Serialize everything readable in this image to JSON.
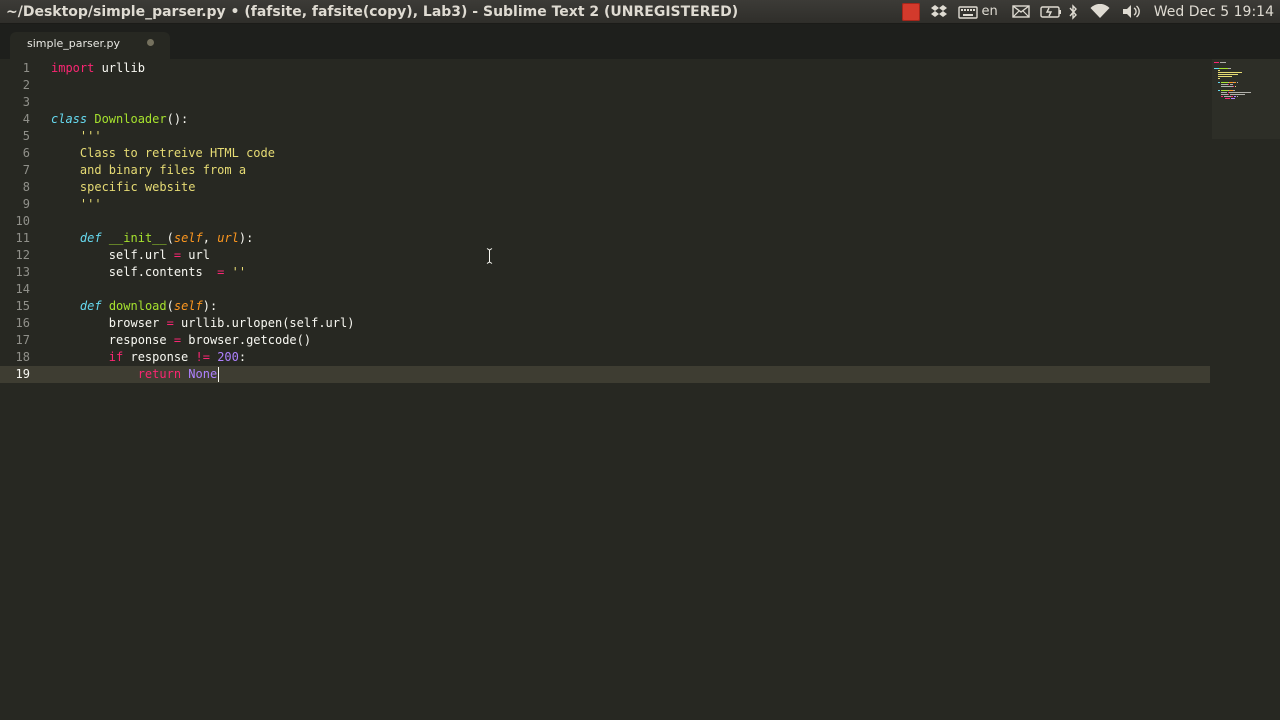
{
  "window": {
    "title": "~/Desktop/simple_parser.py • (fafsite, fafsite(copy), Lab3) - Sublime Text 2 (UNREGISTERED)"
  },
  "tray": {
    "keyboard_layout": "en",
    "clock": "Wed Dec 5 19:14",
    "icons": [
      "red-square-indicator",
      "dropbox-icon",
      "keyboard-icon",
      "mail-icon",
      "battery-icon",
      "bluetooth-icon",
      "wifi-icon",
      "volume-icon"
    ]
  },
  "tabs": [
    {
      "label": "simple_parser.py",
      "modified": true,
      "active": true
    }
  ],
  "editor": {
    "line_numbers": [
      "1",
      "2",
      "3",
      "4",
      "5",
      "6",
      "7",
      "8",
      "9",
      "10",
      "11",
      "12",
      "13",
      "14",
      "15",
      "16",
      "17",
      "18",
      "19"
    ],
    "current_line": "19",
    "lines": [
      [
        {
          "t": "import",
          "c": "keyword"
        },
        {
          "t": " urllib",
          "c": "default"
        }
      ],
      [],
      [],
      [
        {
          "t": "class",
          "c": "storage"
        },
        {
          "t": " ",
          "c": "default"
        },
        {
          "t": "Downloader",
          "c": "entity"
        },
        {
          "t": "():",
          "c": "default"
        }
      ],
      [
        {
          "t": "    '''",
          "c": "string"
        }
      ],
      [
        {
          "t": "    Class to retreive HTML code",
          "c": "string"
        }
      ],
      [
        {
          "t": "    and binary files from a",
          "c": "string"
        }
      ],
      [
        {
          "t": "    specific website",
          "c": "string"
        }
      ],
      [
        {
          "t": "    '''",
          "c": "string"
        }
      ],
      [],
      [
        {
          "t": "    ",
          "c": "default"
        },
        {
          "t": "def",
          "c": "storage"
        },
        {
          "t": " ",
          "c": "default"
        },
        {
          "t": "__init__",
          "c": "entity"
        },
        {
          "t": "(",
          "c": "default"
        },
        {
          "t": "self",
          "c": "param"
        },
        {
          "t": ", ",
          "c": "default"
        },
        {
          "t": "url",
          "c": "param"
        },
        {
          "t": "):",
          "c": "default"
        }
      ],
      [
        {
          "t": "        self.url ",
          "c": "default"
        },
        {
          "t": "=",
          "c": "op"
        },
        {
          "t": " url",
          "c": "default"
        }
      ],
      [
        {
          "t": "        self.contents  ",
          "c": "default"
        },
        {
          "t": "=",
          "c": "op"
        },
        {
          "t": " ",
          "c": "default"
        },
        {
          "t": "''",
          "c": "string"
        }
      ],
      [],
      [
        {
          "t": "    ",
          "c": "default"
        },
        {
          "t": "def",
          "c": "storage"
        },
        {
          "t": " ",
          "c": "default"
        },
        {
          "t": "download",
          "c": "entity"
        },
        {
          "t": "(",
          "c": "default"
        },
        {
          "t": "self",
          "c": "param"
        },
        {
          "t": "):",
          "c": "default"
        }
      ],
      [
        {
          "t": "        browser ",
          "c": "default"
        },
        {
          "t": "=",
          "c": "op"
        },
        {
          "t": " urllib.urlopen(self.url)",
          "c": "default"
        }
      ],
      [
        {
          "t": "        response ",
          "c": "default"
        },
        {
          "t": "=",
          "c": "op"
        },
        {
          "t": " browser.getcode()",
          "c": "default"
        }
      ],
      [
        {
          "t": "        ",
          "c": "default"
        },
        {
          "t": "if",
          "c": "keyword"
        },
        {
          "t": " response ",
          "c": "default"
        },
        {
          "t": "!=",
          "c": "op"
        },
        {
          "t": " ",
          "c": "default"
        },
        {
          "t": "200",
          "c": "number"
        },
        {
          "t": ":",
          "c": "default"
        }
      ],
      [
        {
          "t": "            ",
          "c": "default"
        },
        {
          "t": "return",
          "c": "keyword"
        },
        {
          "t": " ",
          "c": "default"
        },
        {
          "t": "None",
          "c": "const"
        }
      ]
    ]
  },
  "colors": {
    "background": "#272822",
    "keyword": "#f92672",
    "storage": "#66d9ef",
    "entity": "#a6e22e",
    "string": "#e6db74",
    "param": "#fd971f",
    "number": "#ae81ff"
  }
}
